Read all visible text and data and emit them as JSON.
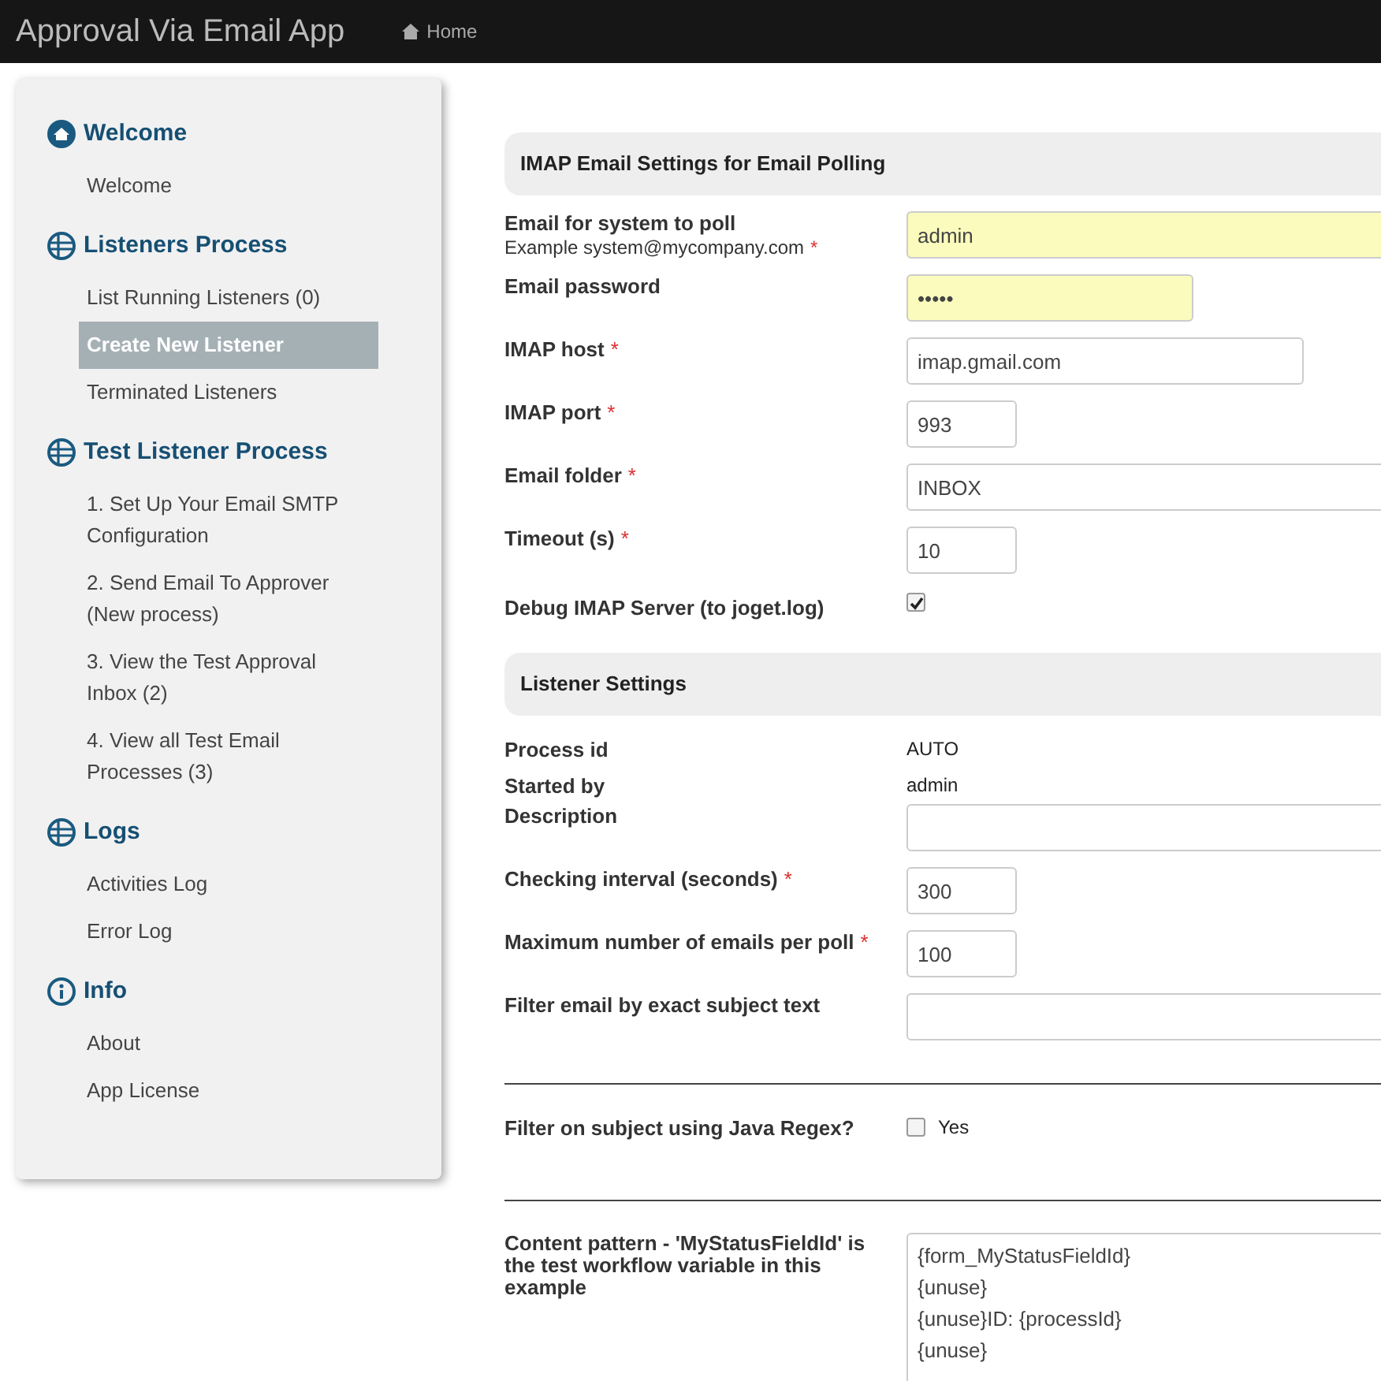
{
  "header": {
    "title": "Approval Via Email App",
    "nav": [
      {
        "label": "Home"
      }
    ]
  },
  "sidebar": {
    "groups": [
      {
        "title": "Welcome",
        "kind": "home",
        "items": [
          {
            "label": "Welcome",
            "selected": false
          }
        ]
      },
      {
        "title": "Listeners Process",
        "kind": "table",
        "items": [
          {
            "label": "List Running Listeners (0)",
            "selected": false
          },
          {
            "label": "Create New Listener",
            "selected": true
          },
          {
            "label": "Terminated Listeners",
            "selected": false
          }
        ]
      },
      {
        "title": "Test Listener Process",
        "kind": "table",
        "items": [
          {
            "label": "1. Set Up Your Email SMTP Configuration",
            "selected": false
          },
          {
            "label": "2. Send Email To Approver (New process)",
            "selected": false
          },
          {
            "label": "3. View the Test Approval Inbox (2)",
            "selected": false
          },
          {
            "label": "4. View all Test Email Processes (3)",
            "selected": false
          }
        ]
      },
      {
        "title": "Logs",
        "kind": "table",
        "items": [
          {
            "label": "Activities Log",
            "selected": false
          },
          {
            "label": "Error Log",
            "selected": false
          }
        ]
      },
      {
        "title": "Info",
        "kind": "info",
        "items": [
          {
            "label": "About",
            "selected": false
          },
          {
            "label": "App License",
            "selected": false
          }
        ]
      }
    ]
  },
  "sections": [
    {
      "title": "IMAP Email Settings for Email Polling",
      "rows": [
        {
          "kind": "email",
          "label": "Email for system to poll",
          "hint": "Example system@mycompany.com",
          "required": "*",
          "value": "admin",
          "autofilled": true
        },
        {
          "kind": "password",
          "label": "Email password",
          "value": "•••••",
          "autofilled": true
        },
        {
          "kind": "host",
          "label": "IMAP host",
          "required": "*",
          "value": "imap.gmail.com",
          "autofilled": false
        },
        {
          "kind": "number",
          "label": "IMAP port",
          "required": "*",
          "value": "993",
          "autofilled": false
        },
        {
          "kind": "text",
          "label": "Email folder",
          "required": "*",
          "value": "INBOX",
          "autofilled": false
        },
        {
          "kind": "number",
          "label": "Timeout (s)",
          "required": "*",
          "value": "10",
          "autofilled": false
        },
        {
          "kind": "checkbox",
          "label": "Debug IMAP Server (to joget.log)",
          "checked": true
        }
      ]
    },
    {
      "title": "Listener Settings",
      "rows": [
        {
          "kind": "static",
          "label": "Process id",
          "value": "AUTO"
        },
        {
          "kind": "static",
          "label": "Started by",
          "value": "admin"
        },
        {
          "kind": "text",
          "label": "Description",
          "autofilled": false
        },
        {
          "kind": "number",
          "label": "Checking interval (seconds)",
          "required": "*",
          "value": "300",
          "autofilled": false
        },
        {
          "kind": "number",
          "label": "Maximum number of emails per poll",
          "required": "*",
          "value": "100",
          "autofilled": false
        },
        {
          "kind": "text",
          "label": "Filter email by exact subject text",
          "autofilled": false
        },
        {
          "kind": "divider"
        },
        {
          "kind": "checkbox",
          "label": "Filter on subject using Java Regex?",
          "checked": false,
          "option": "Yes"
        },
        {
          "kind": "divider"
        },
        {
          "kind": "textarea",
          "label": "Content pattern - 'MyStatusFieldId' is the test workflow variable in this example",
          "value": "{form_MyStatusFieldId}\n{unuse}\n{unuse}ID: {processId}\n{unuse}"
        }
      ]
    }
  ]
}
